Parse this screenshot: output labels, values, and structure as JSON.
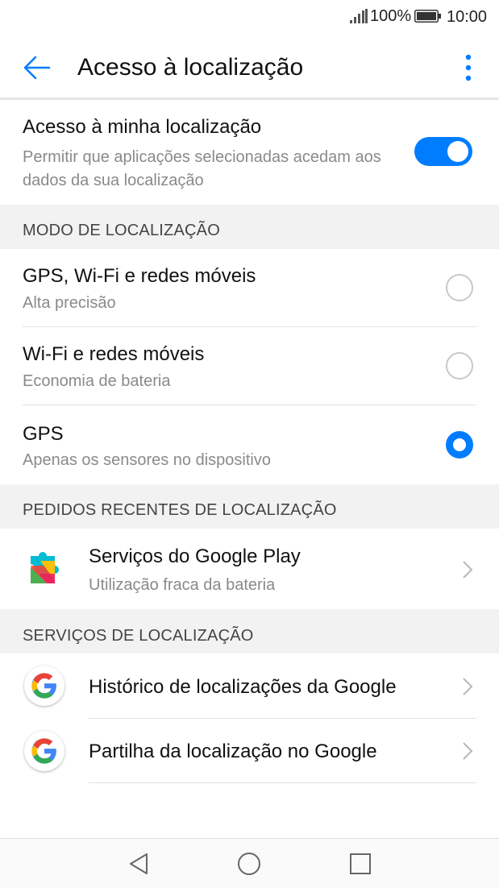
{
  "status_bar": {
    "battery_percent": "100%",
    "time": "10:00"
  },
  "app_bar": {
    "title": "Acesso à localização"
  },
  "master_switch": {
    "title": "Acesso à minha localização",
    "subtitle": "Permitir que aplicações selecionadas acedam aos dados da sua localização",
    "enabled": true,
    "accent_color": "#007dff"
  },
  "location_mode": {
    "header": "MODO DE LOCALIZAÇÃO",
    "options": [
      {
        "title": "GPS, Wi-Fi e redes móveis",
        "subtitle": "Alta precisão",
        "selected": false
      },
      {
        "title": "Wi-Fi e redes móveis",
        "subtitle": "Economia de bateria",
        "selected": false
      },
      {
        "title": "GPS",
        "subtitle": "Apenas os sensores no dispositivo",
        "selected": true
      }
    ]
  },
  "recent_requests": {
    "header": "PEDIDOS RECENTES DE LOCALIZAÇÃO",
    "items": [
      {
        "title": "Serviços do Google Play",
        "subtitle": "Utilização fraca da bateria",
        "icon": "google-play-services-icon"
      }
    ]
  },
  "location_services": {
    "header": "SERVIÇOS DE LOCALIZAÇÃO",
    "items": [
      {
        "title": "Histórico de localizações da Google",
        "icon": "google-icon"
      },
      {
        "title": "Partilha da localização no Google",
        "icon": "google-icon"
      }
    ]
  },
  "nav_bar": {
    "icons": [
      "back-triangle-icon",
      "home-circle-icon",
      "recents-square-icon"
    ]
  }
}
